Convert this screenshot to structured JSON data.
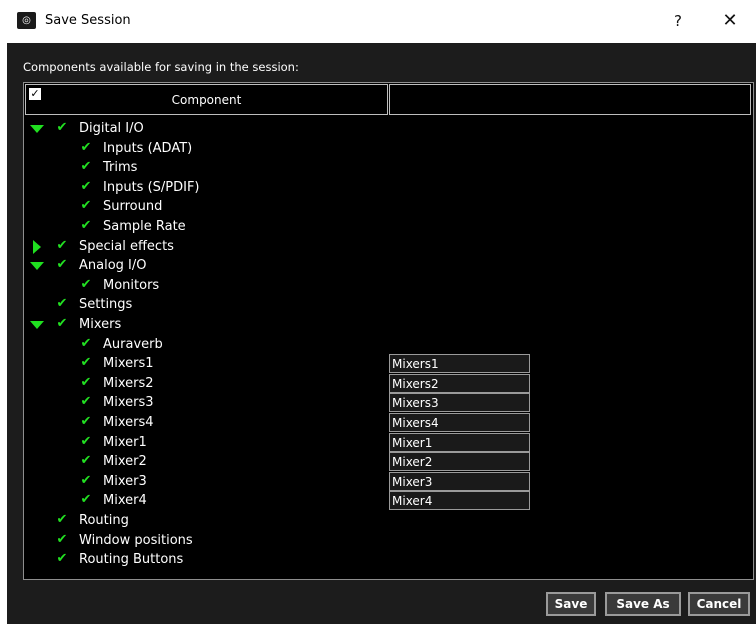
{
  "window": {
    "title": "Save Session",
    "help_label": "?",
    "close_label": "✕"
  },
  "caption": "Components available for saving in the session:",
  "table": {
    "header_check": "✓",
    "column_header": "Component"
  },
  "tree": [
    {
      "label": "Digital I/O",
      "expander": "expanded",
      "checked": true,
      "depth": 0
    },
    {
      "label": "Inputs (ADAT)",
      "expander": "none",
      "checked": true,
      "depth": 1
    },
    {
      "label": "Trims",
      "expander": "none",
      "checked": true,
      "depth": 1
    },
    {
      "label": "Inputs (S/PDIF)",
      "expander": "none",
      "checked": true,
      "depth": 1
    },
    {
      "label": "Surround",
      "expander": "none",
      "checked": true,
      "depth": 1
    },
    {
      "label": "Sample Rate",
      "expander": "none",
      "checked": true,
      "depth": 1
    },
    {
      "label": "Special effects",
      "expander": "collapsed",
      "checked": true,
      "depth": 0
    },
    {
      "label": "Analog I/O",
      "expander": "expanded",
      "checked": true,
      "depth": 0
    },
    {
      "label": "Monitors",
      "expander": "none",
      "checked": true,
      "depth": 1
    },
    {
      "label": "Settings",
      "expander": "none",
      "checked": true,
      "depth": 0
    },
    {
      "label": "Mixers",
      "expander": "expanded",
      "checked": true,
      "depth": 0
    },
    {
      "label": "Auraverb",
      "expander": "none",
      "checked": true,
      "depth": 1
    },
    {
      "label": "Mixers1",
      "expander": "none",
      "checked": true,
      "depth": 1,
      "name": "Mixers1"
    },
    {
      "label": "Mixers2",
      "expander": "none",
      "checked": true,
      "depth": 1,
      "name": "Mixers2"
    },
    {
      "label": "Mixers3",
      "expander": "none",
      "checked": true,
      "depth": 1,
      "name": "Mixers3"
    },
    {
      "label": "Mixers4",
      "expander": "none",
      "checked": true,
      "depth": 1,
      "name": "Mixers4"
    },
    {
      "label": "Mixer1",
      "expander": "none",
      "checked": true,
      "depth": 1,
      "name": "Mixer1"
    },
    {
      "label": "Mixer2",
      "expander": "none",
      "checked": true,
      "depth": 1,
      "name": "Mixer2"
    },
    {
      "label": "Mixer3",
      "expander": "none",
      "checked": true,
      "depth": 1,
      "name": "Mixer3"
    },
    {
      "label": "Mixer4",
      "expander": "none",
      "checked": true,
      "depth": 1,
      "name": "Mixer4"
    },
    {
      "label": "Routing",
      "expander": "none",
      "checked": true,
      "depth": 0
    },
    {
      "label": "Window positions",
      "expander": "none",
      "checked": true,
      "depth": 0
    },
    {
      "label": "Routing Buttons",
      "expander": "none",
      "checked": true,
      "depth": 0
    }
  ],
  "buttons": {
    "save": "Save",
    "save_as": "Save As",
    "cancel": "Cancel"
  },
  "colors": {
    "accent_green": "#22e022",
    "panel_bg": "#000000",
    "dialog_bg": "#1c1c1c"
  },
  "icons": {
    "app": "session-app-icon",
    "check": "green-checkmark",
    "expander_expanded": "green-triangle-down",
    "expander_collapsed": "green-triangle-right"
  }
}
